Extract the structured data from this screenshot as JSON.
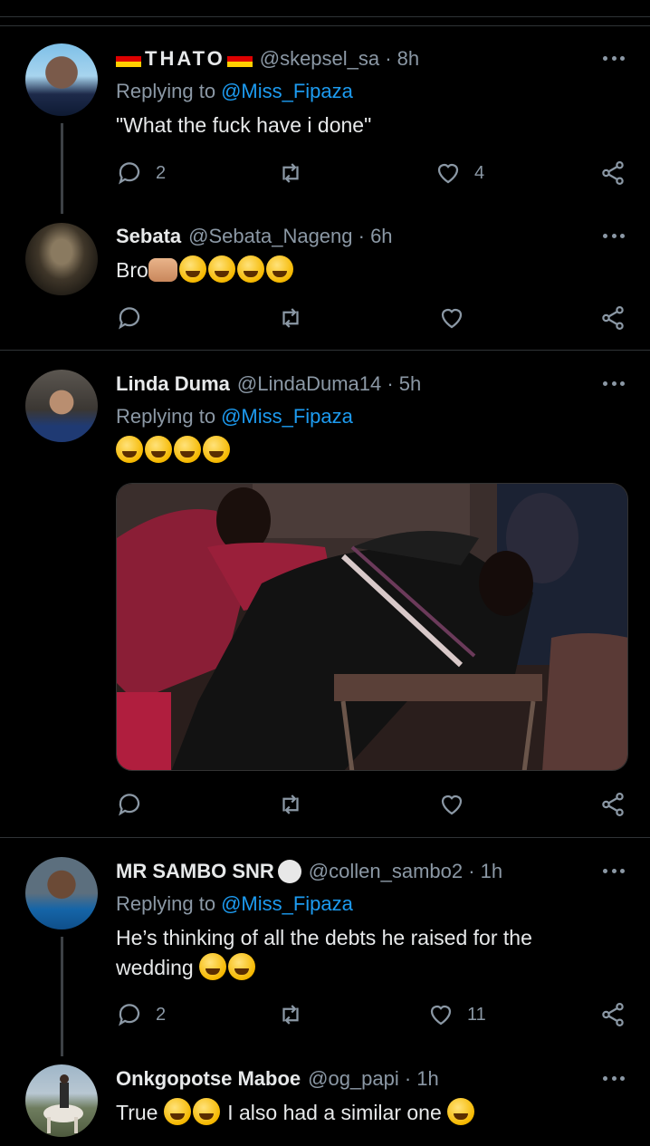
{
  "tweets": [
    {
      "name": "THATO",
      "handle": "@skepsel_sa · 8h",
      "replying_prefix": "Replying to",
      "replying_to": "@Miss_Fipaza",
      "text": "\"What the fuck have i done\"",
      "reply_count": "2",
      "retweet_count": "",
      "like_count": "4"
    },
    {
      "name": "Sebata",
      "handle": "@Sebata_Nageng · 6h",
      "text": "Bro",
      "reply_count": "",
      "retweet_count": "",
      "like_count": ""
    },
    {
      "name": "Linda Duma",
      "handle": "@LindaDuma14 · 5h",
      "replying_prefix": "Replying to",
      "replying_to": "@Miss_Fipaza",
      "text": "",
      "reply_count": "",
      "retweet_count": "",
      "like_count": ""
    },
    {
      "name": "MR SAMBO SNR",
      "handle": "@collen_sambo2 · 1h",
      "replying_prefix": "Replying to",
      "replying_to": "@Miss_Fipaza",
      "text_line1": "He’s thinking of all the debts he raised for the",
      "text_line2": "wedding",
      "reply_count": "2",
      "retweet_count": "",
      "like_count": "11"
    },
    {
      "name": "Onkgopotse Maboe",
      "handle": "@og_papi · 1h",
      "text_part1": "True",
      "text_part2": "I also had a similar one"
    }
  ],
  "colors": {
    "background": "#000000",
    "name": "#e7e9ea",
    "secondary": "#8b98a5",
    "mention": "#1d9bf0",
    "separator": "#2f3336"
  },
  "icons": [
    "reply-icon",
    "retweet-icon",
    "like-icon",
    "share-icon",
    "more-icon"
  ]
}
